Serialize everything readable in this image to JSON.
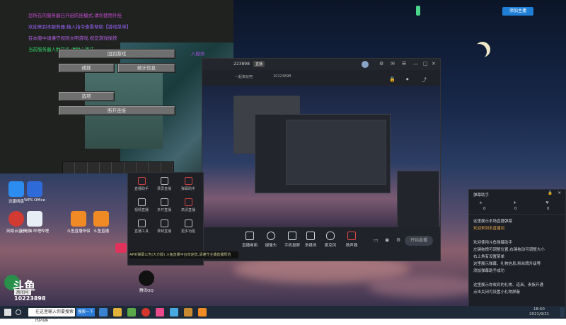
{
  "game": {
    "lines": [
      "您所在的服务器已开启防挂模式,请勿使用外挂",
      "欢迎来到本服务器,输入指令查看帮助【游戏菜单】",
      "在本服中请遵守规则文明游戏,祝您游戏愉快",
      "当前服务器人数较多,请耐心等待"
    ],
    "side_tag": "入服务",
    "buttons": {
      "back": "回到游戏",
      "advancements": "成就",
      "statistics": "统计信息",
      "options": "选项",
      "disconnect": "断开连接"
    }
  },
  "desktop": {
    "icons": [
      {
        "label": "迅雷网盘"
      },
      {
        "label": "WPS Office"
      },
      {
        "label": "网易云音乐"
      },
      {
        "label": "此电脑·哔哩哔哩"
      },
      {
        "label": "斗鱼直播伴侣"
      },
      {
        "label": "斗鱼直播"
      },
      {
        "label": "腾讯QQ"
      }
    ],
    "room_tag": "房间号",
    "room_number": "10223898",
    "top_right_badge": "添加主播"
  },
  "live_window": {
    "room_id": "223898",
    "room_tag": "直播",
    "subtitle_a": "一起来玩吧",
    "subtitle_b": "10223898",
    "tools": [
      {
        "label": "直播画面"
      },
      {
        "label": "摄像头"
      },
      {
        "label": "手机投屏"
      },
      {
        "label": "多媒体"
      },
      {
        "label": "麦克风"
      },
      {
        "label": "扬声器"
      }
    ],
    "start_button": "开始直播"
  },
  "side_panel": {
    "items": [
      {
        "label": "直播助手"
      },
      {
        "label": "录屏直播"
      },
      {
        "label": "弹幕助手"
      },
      {
        "label": "视频直播"
      },
      {
        "label": "多开直播"
      },
      {
        "label": "高清直播"
      },
      {
        "label": "直播工具"
      },
      {
        "label": "录制直播"
      },
      {
        "label": "更多功能"
      }
    ],
    "notice": "APIK弹幕公告(大方版) 斗鱼直播平台欢迎您,请遵守主播直播规范"
  },
  "assistant": {
    "title": "弹幕助手",
    "stats": [
      "0",
      "0",
      "0"
    ],
    "lines": [
      "这里展示本场直播弹幕",
      "欢迎来到本直播间",
      "欢迎使用斗鱼弹幕助手",
      "左键拖拽可调整位置,右键拖动可调整大小",
      "右上角有设置菜单",
      "这里展示弹幕、礼物信息,粉丝牌升级等",
      "添加弹幕助手成功",
      "",
      "这里展示你收到的礼物、道具、贵族开通",
      "点击关闭可设置小礼物屏蔽"
    ]
  },
  "taskbar": {
    "search_placeholder": "在这里输入你要搜索的内容",
    "search_button": "搜索一下",
    "time": "18:50",
    "date": "2021/9/21"
  }
}
